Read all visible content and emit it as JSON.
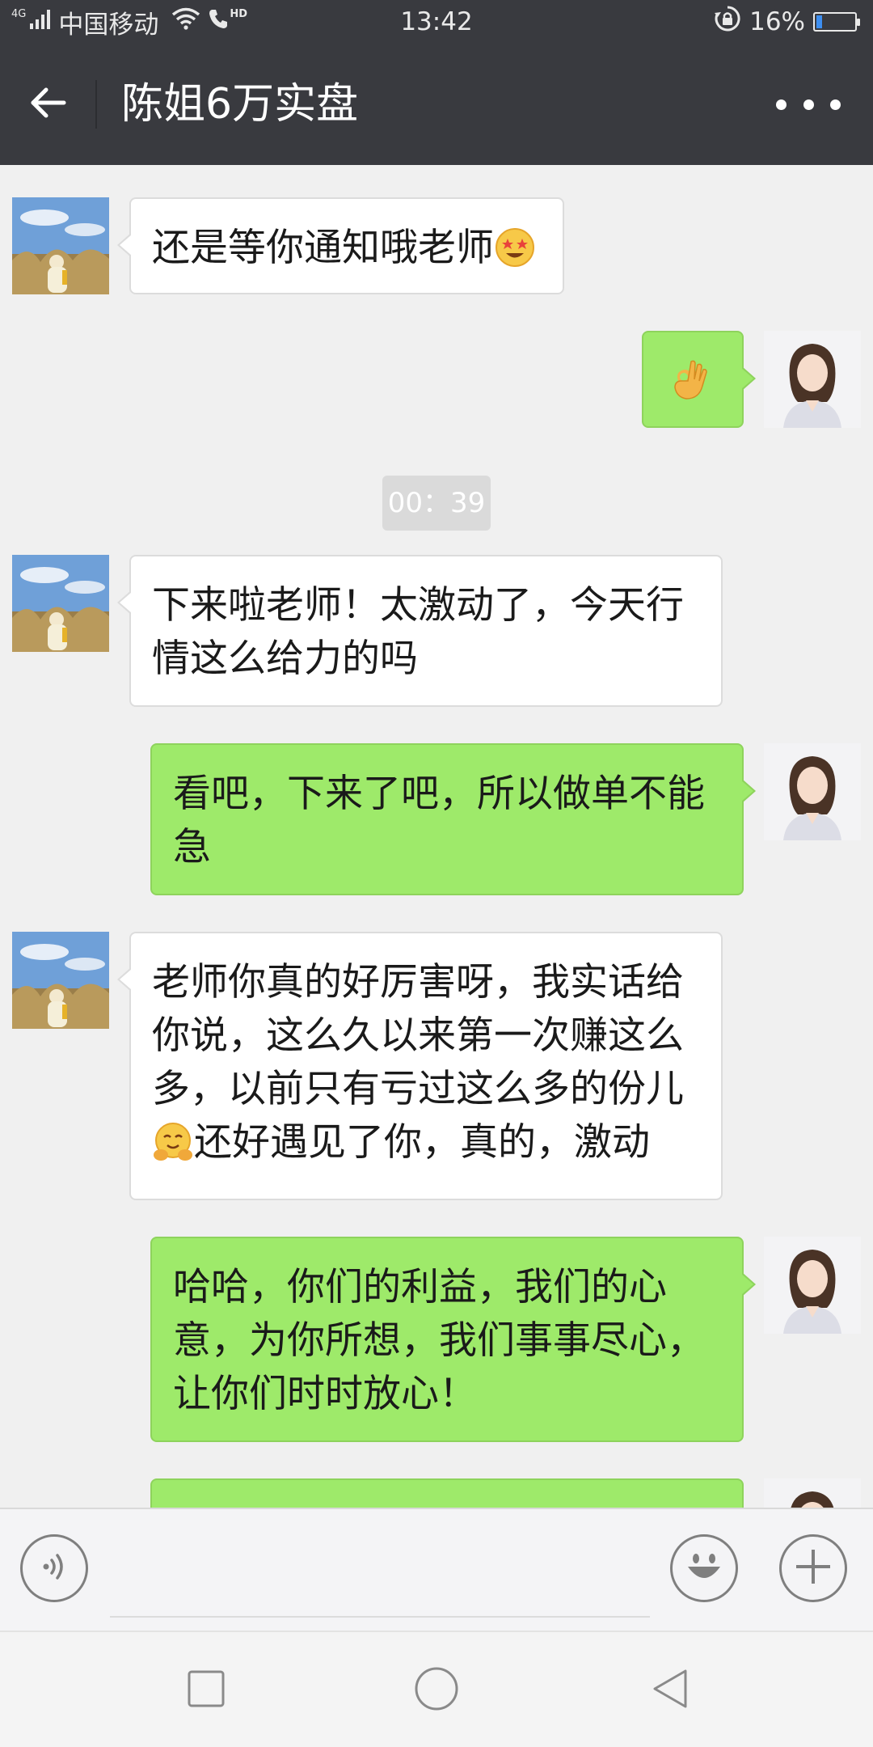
{
  "status_bar": {
    "network_tag": "4G",
    "carrier": "中国移动",
    "hd_tag": "HD",
    "time": "13:42",
    "battery_text": "16%",
    "battery_level": 0.16,
    "icons": [
      "signal-icon",
      "wifi-icon",
      "phone-hd-icon",
      "rotation-lock-icon",
      "battery-icon"
    ]
  },
  "header": {
    "title": "陈姐6万实盘",
    "back_icon": "arrow-left-icon",
    "more_icon": "more-dots-icon"
  },
  "chat": {
    "time_separator": "00：39",
    "messages": [
      {
        "from": "other",
        "text": "还是等你通知哦老师",
        "emoji_after": "star-struck-emoji"
      },
      {
        "from": "self",
        "emoji_only": "ok-hand-emoji"
      },
      {
        "from": "other",
        "line1": "下来啦老师！太激动了，今天行",
        "line2": "情这么给力的吗"
      },
      {
        "from": "self",
        "line1": "看吧，下来了吧，所以做单不能",
        "line2": "急"
      },
      {
        "from": "other",
        "line1": "老师你真的好厉害呀，我实话给",
        "line2": "你说，这么久以来第一次赚这么",
        "line3": "多，以前只有亏过这么多的份儿",
        "line4": "还好遇见了你，真的，激动",
        "emoji_before_line4": "hugging-face-emoji"
      },
      {
        "from": "self",
        "line1": "哈哈，你们的利益，我们的心",
        "line2": "意，为你所想，我们事事尽心，",
        "line3": "让你们时时放心！"
      },
      {
        "from": "self",
        "text": ""
      }
    ]
  },
  "input_bar": {
    "voice_icon": "voice-icon",
    "emoji_icon": "emoji-smile-icon",
    "plus_icon": "plus-icon"
  },
  "nav_bar": {
    "recents_icon": "square-icon",
    "home_icon": "circle-icon",
    "back_icon": "triangle-back-icon"
  },
  "colors": {
    "header_bg": "#393a3f",
    "chat_bg": "#f0f0f0",
    "outgoing_bubble": "#9eea6a",
    "incoming_bubble": "#ffffff"
  }
}
